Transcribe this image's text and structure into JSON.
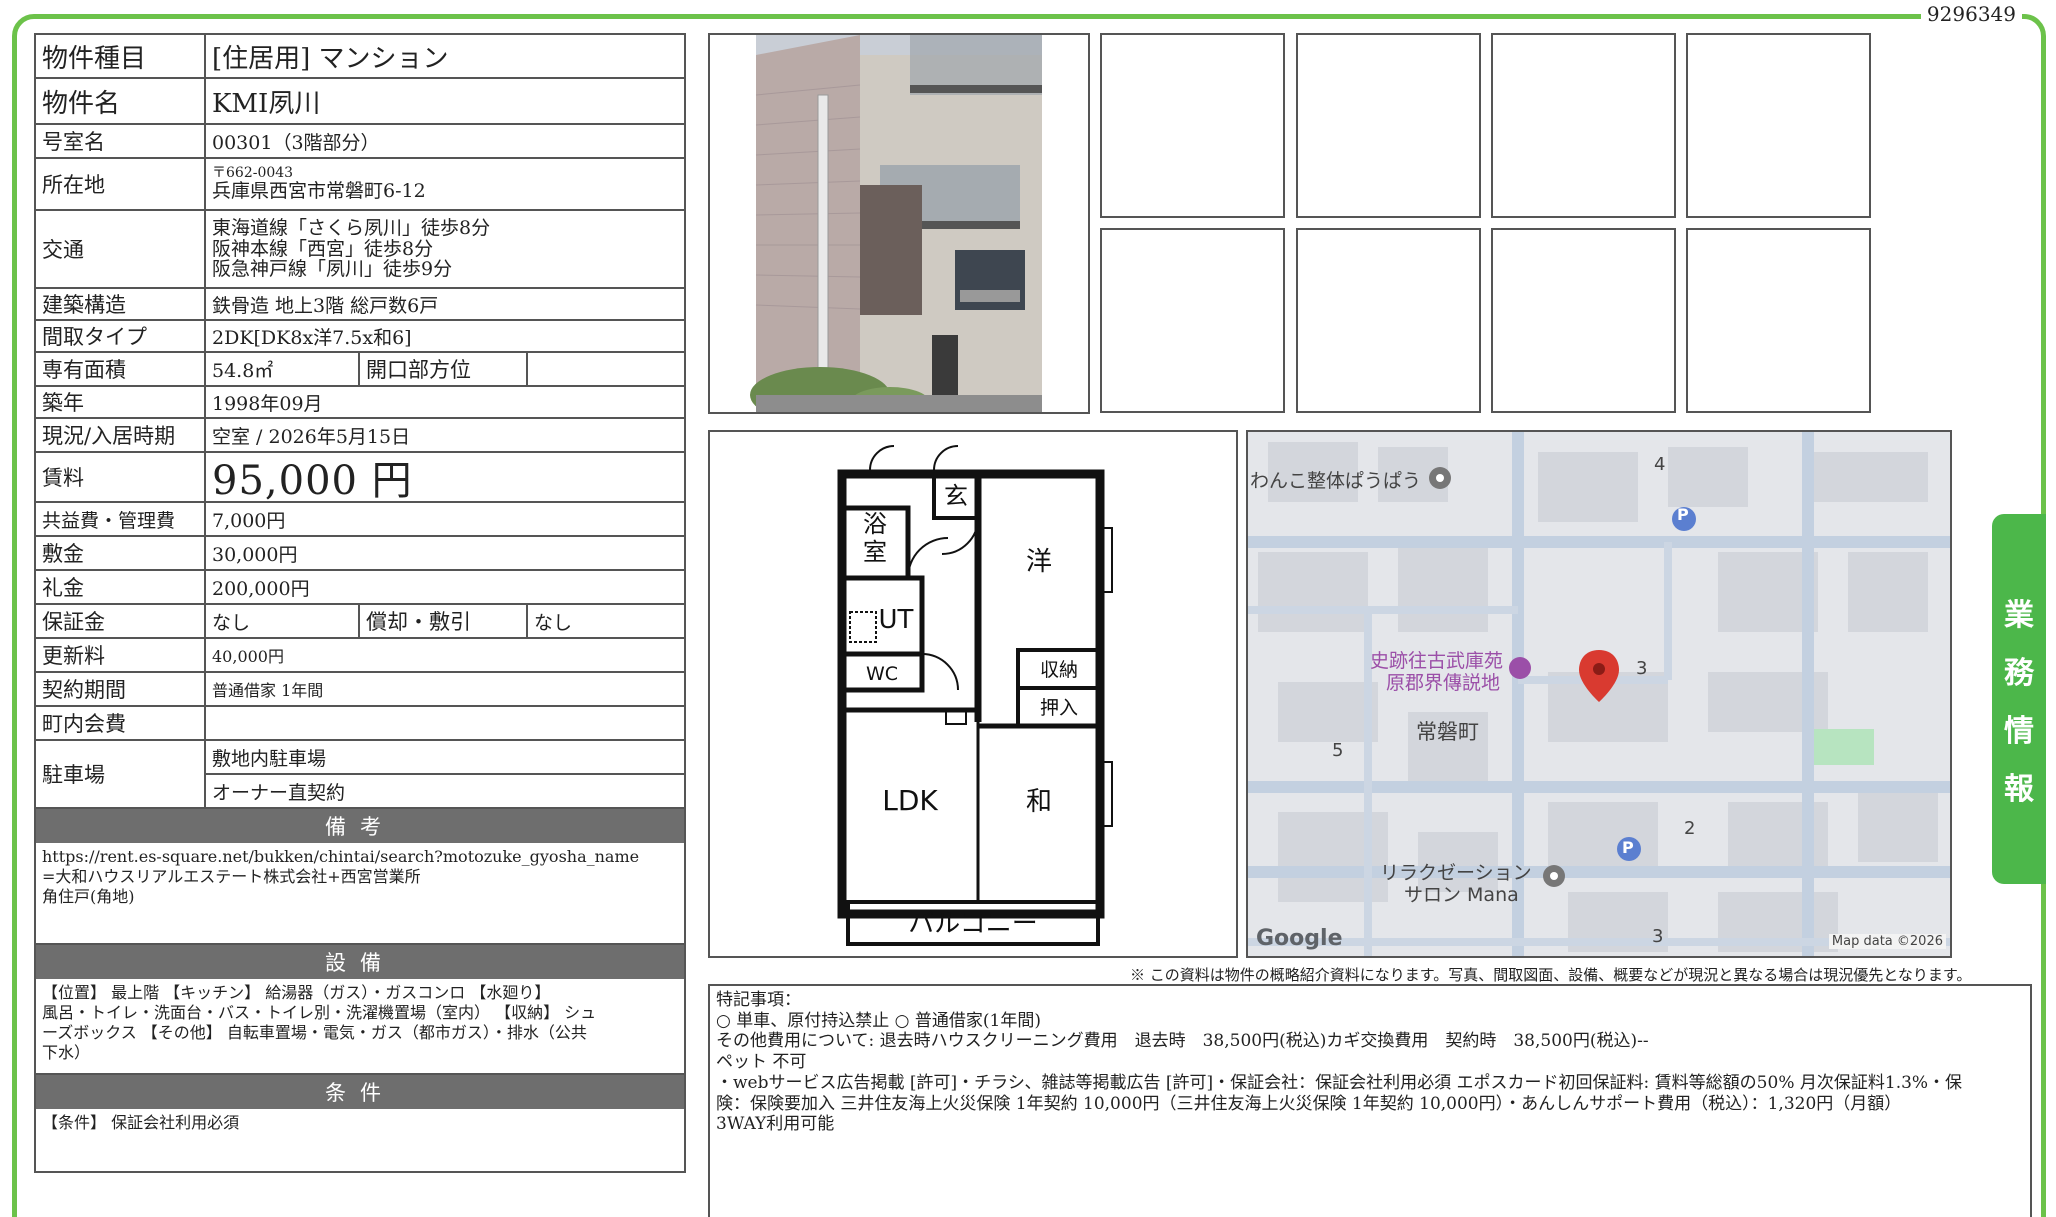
{
  "doc_id": "9296349",
  "property": {
    "type_label": "物件種目",
    "type_value": "[住居用] マンション",
    "name_label": "物件名",
    "name_value": "KMI夙川",
    "room_label": "号室名",
    "room_value": "00301（3階部分）",
    "address_label": "所在地",
    "postal": "〒662-0043",
    "address": "兵庫県西宮市常磐町6-12",
    "transit_label": "交通",
    "transit": [
      "東海道線「さくら夙川」徒歩8分",
      "阪神本線「西宮」徒歩8分",
      "阪急神戸線「夙川」徒歩9分"
    ],
    "structure_label": "建築構造",
    "structure_value": "鉄骨造 地上3階 総戸数6戸",
    "layout_label": "間取タイプ",
    "layout_value": "2DK[DK8x洋7.5x和6]",
    "area_label": "専有面積",
    "area_value": "54.8㎡",
    "direction_label": "開口部方位",
    "direction_value": "",
    "built_label": "築年",
    "built_value": "1998年09月",
    "status_label": "現況/入居時期",
    "status_value": "空室 / 2026年5月15日",
    "rent_label": "賃料",
    "rent_value": "95,000 円",
    "fee_label": "共益費・管理費",
    "fee_value": "7,000円",
    "deposit_label": "敷金",
    "deposit_value": "30,000円",
    "key_money_label": "礼金",
    "key_money_value": "200,000円",
    "guarantee_label": "保証金",
    "guarantee_value": "なし",
    "amort_label": "償却・敷引",
    "amort_value": "なし",
    "renewal_label": "更新料",
    "renewal_value": "40,000円",
    "contract_label": "契約期間",
    "contract_value": "普通借家 1年間",
    "town_fee_label": "町内会費",
    "town_fee_value": "",
    "parking_label": "駐車場",
    "parking_values": [
      "敷地内駐車場",
      "オーナー直契約"
    ]
  },
  "sections": {
    "remarks_title": "備考",
    "remarks_lines": [
      "https://rent.es-square.net/bukken/chintai/search?motozuke_gyosha_name",
      "=大和ハウスリアルエステート株式会社+西宮営業所",
      "角住戸(角地)"
    ],
    "equipment_title": "設備",
    "equipment_lines": [
      "【位置】 最上階 【キッチン】 給湯器（ガス）・ガスコンロ 【水廻り】",
      "風呂・トイレ・洗面台・バス・トイレ別・洗濯機置場（室内） 【収納】 シュ",
      "ーズボックス 【その他】 自転車置場・電気・ガス（都市ガス）・排水（公共",
      "下水）"
    ],
    "conditions_title": "条件",
    "conditions_text": "【条件】 保証会社利用必須"
  },
  "floorplan": {
    "labels": [
      "玄",
      "浴",
      "室",
      "洋",
      "UT",
      "WC",
      "収納",
      "押入",
      "LDK",
      "和",
      "バルコニー"
    ]
  },
  "map": {
    "places": [
      "わんこ整体ぱうぱう",
      "史跡往古武庫苑",
      "原郡界傳説地",
      "常磐町",
      "リラクゼーション",
      "サロン Mana"
    ],
    "numbers": [
      "4",
      "3",
      "5",
      "2",
      "3"
    ],
    "parking_icon_text": "P",
    "google": "Google",
    "attribution": "Map data ©2026",
    "colors": {
      "road": "#c5d2e2",
      "block": "#dcdfe5",
      "pin": "#d93a30",
      "park": "#b7e4c0"
    }
  },
  "notice": "※ この資料は物件の概略紹介資料になります。写真、間取図面、設備、概要などが現況と異なる場合は現況優先となります。",
  "special_notes": [
    "特記事項：",
    "○ 単車、原付持込禁止 ○ 普通借家(1年間)",
    "その他費用について: 退去時ハウスクリーニング費用　退去時　38,500円(税込)カギ交換費用　契約時　38,500円(税込)--",
    "ペット 不可",
    "・webサービス広告掲載 [許可]・チラシ、雑誌等掲載広告 [許可]・保証会社：保証会社利用必須 エポスカード初回保証料: 賃料等総額の50% 月次保証料1.3%・保",
    "険：保険要加入 三井住友海上火災保険 1年契約 10,000円（三井住友海上火災保険 1年契約 10,000円）・あんしんサポート費用（税込）：1,320円（月額）",
    "3WAY利用可能"
  ],
  "side_tab": [
    "業",
    "務",
    "情",
    "報"
  ]
}
